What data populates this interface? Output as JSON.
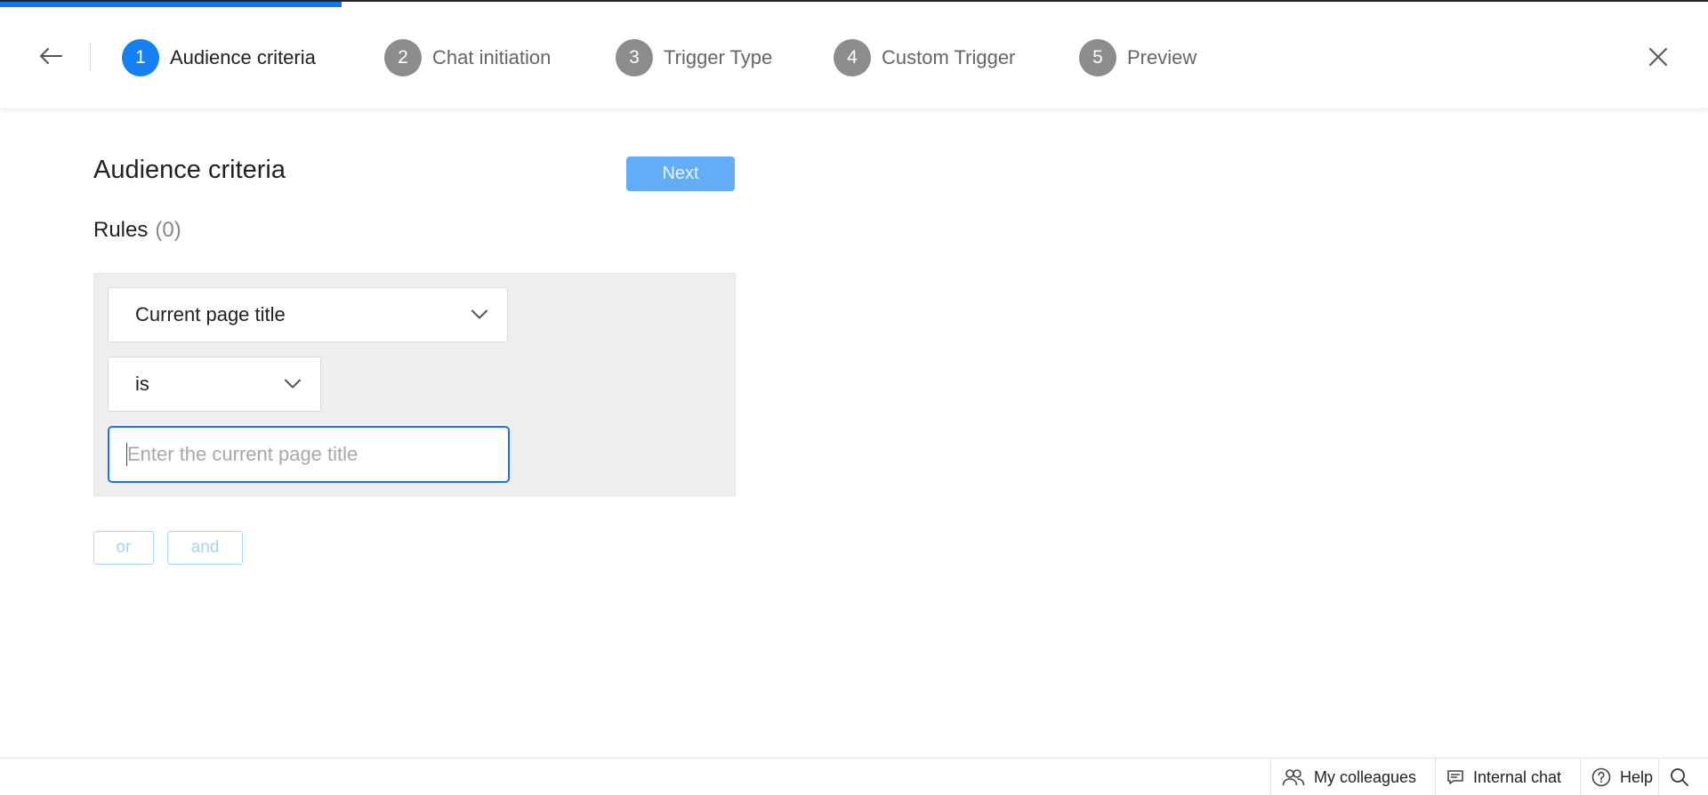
{
  "stepper": {
    "progress_fraction": 0.2,
    "steps": [
      {
        "number": "1",
        "label": "Audience criteria",
        "active": true
      },
      {
        "number": "2",
        "label": "Chat initiation",
        "active": false
      },
      {
        "number": "3",
        "label": "Trigger Type",
        "active": false
      },
      {
        "number": "4",
        "label": "Custom Trigger",
        "active": false
      },
      {
        "number": "5",
        "label": "Preview",
        "active": false
      }
    ],
    "back_icon": "arrow-left-icon",
    "close_icon": "close-icon"
  },
  "main": {
    "title": "Audience criteria",
    "next_label": "Next",
    "rules_label": "Rules",
    "rules_count": "(0)",
    "rule": {
      "field_value": "Current page title",
      "operator_value": "is",
      "input_value": "",
      "input_placeholder": "Enter the current page title"
    },
    "or_label": "or",
    "and_label": "and"
  },
  "bottombar": {
    "colleagues_label": "My colleagues",
    "internal_chat_label": "Internal chat",
    "help_label": "Help",
    "icons": [
      "people-icon",
      "chat-bubble-icon",
      "question-circle-icon",
      "search-icon"
    ]
  },
  "colors": {
    "accent": "#1580f2",
    "progress": "#1a73e8",
    "next_button": "#63adf7",
    "inactive_step": "#8c8c8c"
  }
}
